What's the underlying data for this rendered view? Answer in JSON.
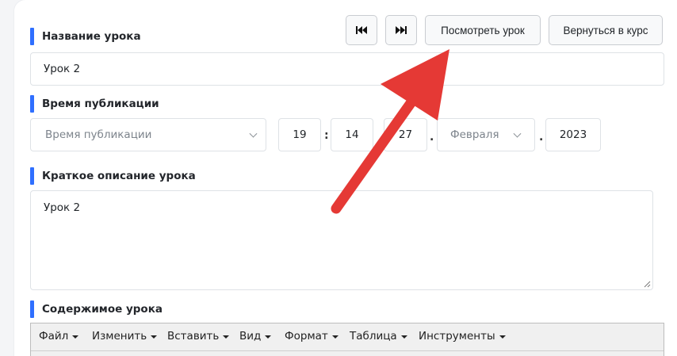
{
  "form": {
    "lesson_name_label": "Название урока",
    "lesson_name_value": "Урок 2",
    "publish_time_label": "Время публикации",
    "publish_time_select_placeholder": "Время публикации",
    "hour": "19",
    "minute": "14",
    "time_sep": ":",
    "day": "27",
    "month": "Февраля",
    "year": "2023",
    "date_sep": ".",
    "short_desc_label": "Краткое описание урока",
    "short_desc_value": "Урок 2",
    "content_label": "Содержимое урока"
  },
  "header_buttons": {
    "prev_icon": "skip-back-icon",
    "next_icon": "skip-forward-icon",
    "view_lesson": "Посмотреть урок",
    "back_to_course": "Вернуться в курс"
  },
  "editor_menu": [
    "Файл",
    "Изменить",
    "Вставить",
    "Вид",
    "Формат",
    "Таблица",
    "Инструменты"
  ],
  "colors": {
    "accent": "#2f6fff",
    "arrow": "#e53935"
  }
}
